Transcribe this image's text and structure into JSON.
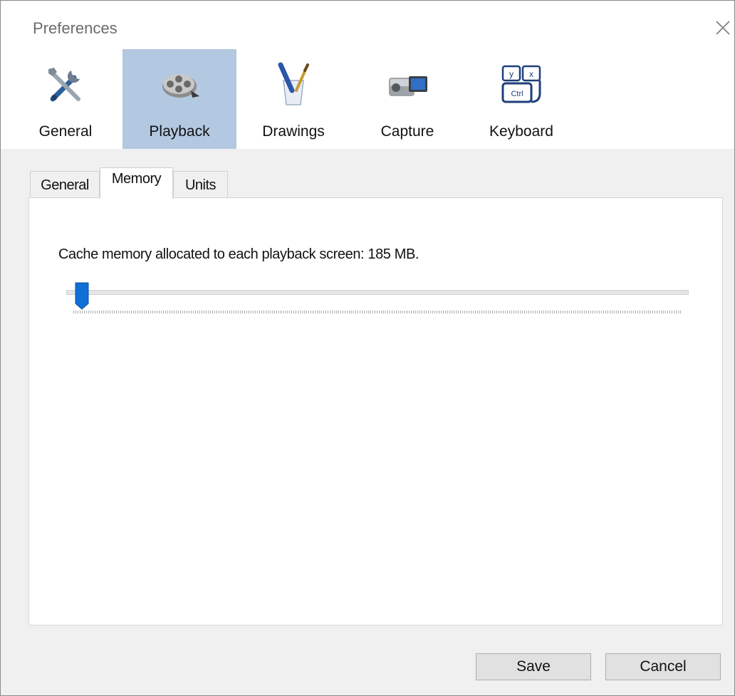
{
  "window": {
    "title": "Preferences"
  },
  "categories": [
    {
      "label": "General",
      "icon": "tools-icon"
    },
    {
      "label": "Playback",
      "icon": "film-reel-icon",
      "selected": true
    },
    {
      "label": "Drawings",
      "icon": "brush-cup-icon"
    },
    {
      "label": "Capture",
      "icon": "camcorder-icon"
    },
    {
      "label": "Keyboard",
      "icon": "keyboard-keys-icon"
    }
  ],
  "tabs": [
    {
      "label": "General"
    },
    {
      "label": "Memory",
      "active": true
    },
    {
      "label": "Units"
    }
  ],
  "memory": {
    "label": "Cache memory allocated to each playback screen: 185 MB.",
    "slider_value_fraction": 0.01
  },
  "buttons": {
    "save": "Save",
    "cancel": "Cancel"
  },
  "colors": {
    "selected_category": "#b3c8e1",
    "slider_thumb": "#0f6fd6"
  }
}
